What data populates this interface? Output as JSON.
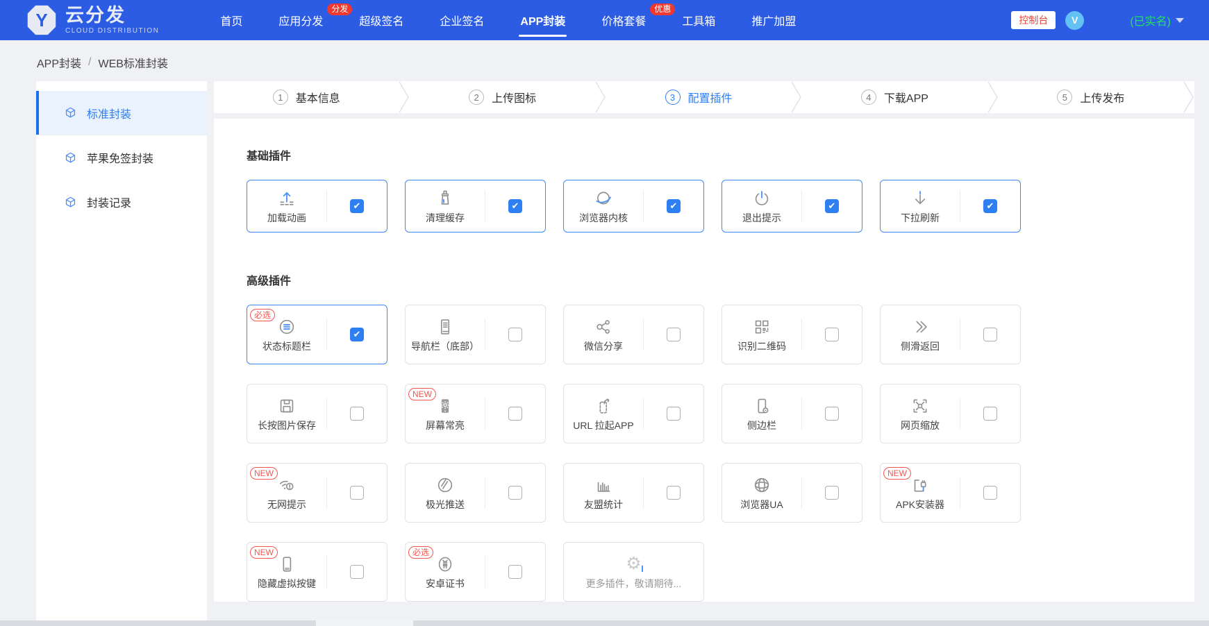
{
  "nav": {
    "logo": {
      "letter": "Y",
      "title": "云分发",
      "subtitle": "CLOUD DISTRIBUTION"
    },
    "items": [
      {
        "label": "首页"
      },
      {
        "label": "应用分发",
        "badge": "分发"
      },
      {
        "label": "超级签名"
      },
      {
        "label": "企业签名"
      },
      {
        "label": "APP封装",
        "active": true
      },
      {
        "label": "价格套餐",
        "badge": "优惠"
      },
      {
        "label": "工具箱"
      },
      {
        "label": "推广加盟"
      }
    ],
    "console_button": "控制台",
    "avatar_letter": "V",
    "realname": "(已实名)"
  },
  "breadcrumb": {
    "items": [
      "APP封装",
      "WEB标准封装"
    ],
    "separator": "/"
  },
  "sidebar": {
    "items": [
      {
        "label": "标准封装",
        "active": true
      },
      {
        "label": "苹果免签封装"
      },
      {
        "label": "封装记录"
      }
    ]
  },
  "steps": {
    "items": [
      {
        "num": "1",
        "label": "基本信息"
      },
      {
        "num": "2",
        "label": "上传图标"
      },
      {
        "num": "3",
        "label": "配置插件",
        "active": true
      },
      {
        "num": "4",
        "label": "下载APP"
      },
      {
        "num": "5",
        "label": "上传发布"
      }
    ]
  },
  "sections": {
    "basic": {
      "title": "基础插件",
      "items": [
        {
          "label": "加载动画",
          "icon": "upload-animation-icon",
          "checked": true
        },
        {
          "label": "清理缓存",
          "icon": "clean-cache-icon",
          "checked": true
        },
        {
          "label": "浏览器内核",
          "icon": "browser-kernel-icon",
          "checked": true
        },
        {
          "label": "退出提示",
          "icon": "exit-prompt-icon",
          "checked": true
        },
        {
          "label": "下拉刷新",
          "icon": "pull-refresh-icon",
          "checked": true
        }
      ]
    },
    "advanced": {
      "title": "高级插件",
      "items": [
        {
          "label": "状态标题栏",
          "icon": "status-bar-icon",
          "checked": true,
          "badge": "必选"
        },
        {
          "label": "导航栏（底部）",
          "icon": "bottom-navbar-icon",
          "checked": false
        },
        {
          "label": "微信分享",
          "icon": "wechat-share-icon",
          "checked": false
        },
        {
          "label": "识别二维码",
          "icon": "qrcode-scan-icon",
          "checked": false
        },
        {
          "label": "侧滑返回",
          "icon": "swipe-back-icon",
          "checked": false
        },
        {
          "label": "长按图片保存",
          "icon": "image-save-icon",
          "checked": false
        },
        {
          "label": "屏幕常亮",
          "icon": "screen-bright-icon",
          "checked": false,
          "badge": "NEW"
        },
        {
          "label": "URL 拉起APP",
          "icon": "url-launch-icon",
          "checked": false
        },
        {
          "label": "侧边栏",
          "icon": "sidebar-plugin-icon",
          "checked": false
        },
        {
          "label": "网页缩放",
          "icon": "page-zoom-icon",
          "checked": false
        },
        {
          "label": "无网提示",
          "icon": "no-network-icon",
          "checked": false,
          "badge": "NEW"
        },
        {
          "label": "极光推送",
          "icon": "jpush-icon",
          "checked": false
        },
        {
          "label": "友盟统计",
          "icon": "stats-chart-icon",
          "checked": false
        },
        {
          "label": "浏览器UA",
          "icon": "browser-ua-icon",
          "checked": false
        },
        {
          "label": "APK安装器",
          "icon": "apk-installer-icon",
          "checked": false,
          "badge": "NEW"
        },
        {
          "label": "隐藏虚拟按键",
          "icon": "hide-virtual-keys-icon",
          "checked": false,
          "badge": "NEW"
        },
        {
          "label": "安卓证书",
          "icon": "android-cert-icon",
          "checked": false,
          "badge": "必选"
        },
        {
          "label": "更多插件，敬请期待...",
          "icon": "more-plugins-icon",
          "more": true
        }
      ]
    }
  },
  "colors": {
    "nav_blue": "#2c5ce4",
    "accent_blue": "#2d7ff2",
    "card_selected_border": "#3d8af7",
    "badge_red": "#f0382f",
    "badge_outline_red": "#f5564c",
    "realname_green": "#23e35c",
    "page_bg": "#f0f1f4"
  }
}
